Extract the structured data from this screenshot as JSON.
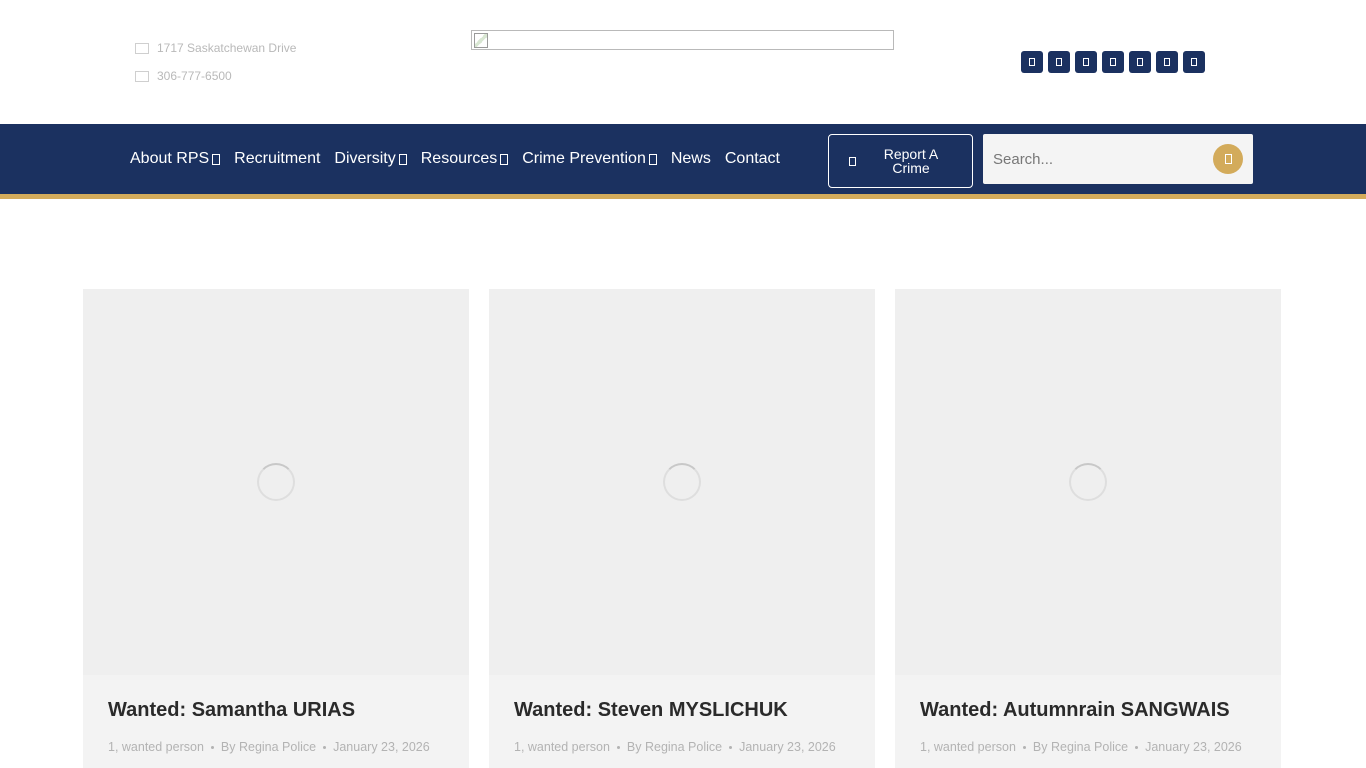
{
  "header": {
    "address": "1717 Saskatchewan Drive",
    "phone": "306-777-6500",
    "social_icons": [
      "facebook-icon",
      "twitter-icon",
      "instagram-icon",
      "youtube-icon",
      "linkedin-icon",
      "tiktok-icon",
      "email-icon"
    ]
  },
  "nav": {
    "items": [
      {
        "label": "About RPS",
        "dropdown": true
      },
      {
        "label": "Recruitment",
        "dropdown": false
      },
      {
        "label": "Diversity",
        "dropdown": true
      },
      {
        "label": "Resources",
        "dropdown": true
      },
      {
        "label": "Crime Prevention",
        "dropdown": true
      },
      {
        "label": "News",
        "dropdown": false
      },
      {
        "label": "Contact",
        "dropdown": false
      }
    ],
    "report_button": "Report A Crime",
    "search_placeholder": "Search..."
  },
  "colors": {
    "navy": "#1b3160",
    "gold": "#d3ab5b"
  },
  "posts": [
    {
      "title": "Wanted: Samantha URIAS",
      "category": "1, wanted person",
      "author": "By Regina Police",
      "date": "January 23, 2026"
    },
    {
      "title": "Wanted: Steven MYSLICHUK",
      "category": "1, wanted person",
      "author": "By Regina Police",
      "date": "January 23, 2026"
    },
    {
      "title": "Wanted: Autumnrain SANGWAIS",
      "category": "1, wanted person",
      "author": "By Regina Police",
      "date": "January 23, 2026"
    }
  ]
}
